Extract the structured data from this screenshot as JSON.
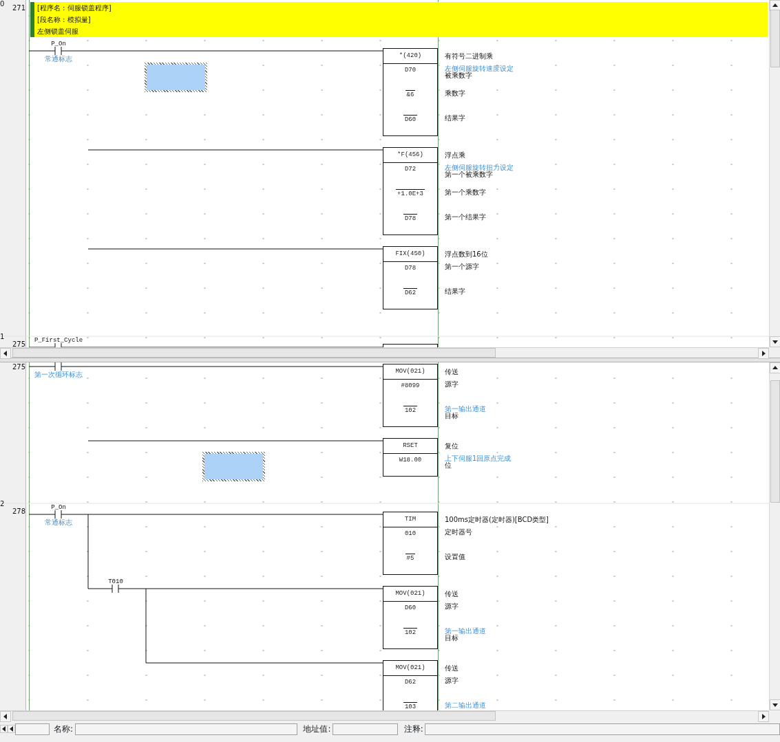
{
  "upper_pane": {
    "rungs": [
      {
        "index": "0",
        "step": "271",
        "header": [
          "[程序名 : 伺服锁盖程序]",
          "[段名称 : 模拟量]",
          "左侧锁盖伺服"
        ],
        "contact": {
          "name": "P_On",
          "comment": "常通标志"
        },
        "branches": [
          {
            "instructions": [
              {
                "mnemonic": "*(420)",
                "description": "有符号二进制乘",
                "operands": [
                  {
                    "value": "D70",
                    "comment": "左侧伺服旋转速度设定",
                    "label": "被乘数字"
                  },
                  {
                    "value": "&6",
                    "label": "乘数字"
                  },
                  {
                    "value": "D60",
                    "label": "结果字"
                  }
                ]
              },
              {
                "mnemonic": "*F(456)",
                "description": "浮点乘",
                "operands": [
                  {
                    "value": "D72",
                    "comment": "左侧伺服旋转扭力设定",
                    "label": "第一个被乘数字"
                  },
                  {
                    "value": "+1.0E+3",
                    "label": "第一个乘数字"
                  },
                  {
                    "value": "D78",
                    "label": "第一个结果字"
                  }
                ]
              },
              {
                "mnemonic": "FIX(450)",
                "description": "浮点数到16位",
                "operands": [
                  {
                    "value": "D78",
                    "label": "第一个源字"
                  },
                  {
                    "value": "D62",
                    "label": "结果字"
                  }
                ]
              }
            ]
          }
        ]
      },
      {
        "index": "1",
        "step": "275",
        "contact": {
          "name": "P_First_Cycle"
        }
      }
    ]
  },
  "lower_pane": {
    "rungs": [
      {
        "step": "275",
        "cut_top": true,
        "contact": {
          "comment": "第一次循环标志"
        },
        "branches": [
          {
            "instructions": [
              {
                "mnemonic": "MOV(021)",
                "description": "传送",
                "operands": [
                  {
                    "value": "#8099",
                    "label": "源字"
                  },
                  {
                    "value": "102",
                    "comment": "第一输出通道",
                    "label": "目标"
                  }
                ]
              },
              {
                "mnemonic": "RSET",
                "description": "复位",
                "operands": [
                  {
                    "value": "W18.00",
                    "comment": "上下伺服1回原点完成",
                    "label": "位"
                  }
                ]
              }
            ]
          }
        ]
      },
      {
        "index": "2",
        "step": "278",
        "contact": {
          "name": "P_On",
          "comment": "常通标志"
        },
        "branches": [
          {
            "instructions": [
              {
                "mnemonic": "TIM",
                "description": "100ms定时器(定时器)[BCD类型]",
                "operands": [
                  {
                    "value": "010",
                    "label": "定时器号"
                  },
                  {
                    "value": "#5",
                    "label": "设置值"
                  }
                ]
              }
            ]
          },
          {
            "contact": {
              "name": "T010"
            },
            "instructions": [
              {
                "mnemonic": "MOV(021)",
                "description": "传送",
                "operands": [
                  {
                    "value": "D60",
                    "label": "源字"
                  },
                  {
                    "value": "102",
                    "comment": "第一输出通道",
                    "label": "目标"
                  }
                ]
              },
              {
                "mnemonic": "MOV(021)",
                "description": "传送",
                "operands": [
                  {
                    "value": "D62",
                    "label": "源字"
                  },
                  {
                    "value": "103",
                    "comment": "第二输出通道"
                  }
                ]
              }
            ]
          }
        ]
      }
    ]
  },
  "status_bar": {
    "fields": [
      {
        "label": "名称:"
      },
      {
        "label": "地址值:"
      },
      {
        "label": "注释:"
      }
    ]
  }
}
